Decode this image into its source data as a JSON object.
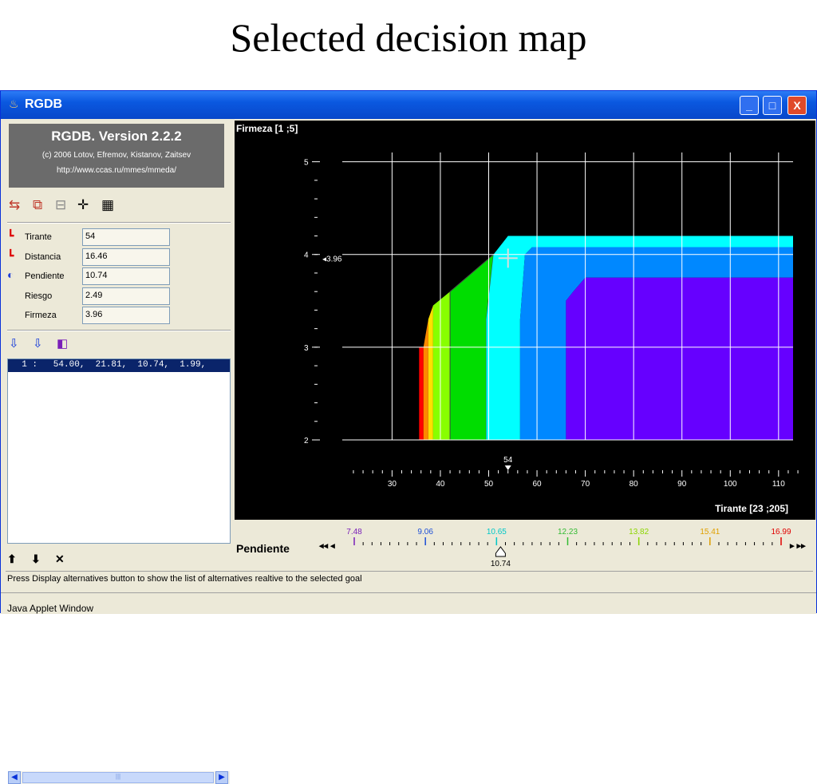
{
  "slide": {
    "title": "Selected decision map"
  },
  "window": {
    "title": "RGDB",
    "controls": {
      "minimize": "_",
      "maximize": "□",
      "close": "X"
    }
  },
  "info": {
    "title": "RGDB. Version 2.2.2",
    "authors": "(c) 2006 Lotov, Efremov, Kistanov, Zaitsev",
    "url": "http://www.ccas.ru/mmes/mmeda/"
  },
  "fields": [
    {
      "label": "Tirante",
      "value": "54"
    },
    {
      "label": "Distancia",
      "value": "16.46"
    },
    {
      "label": "Pendiente",
      "value": "10.74"
    },
    {
      "label": "Riesgo",
      "value": "2.49"
    },
    {
      "label": "Firmeza",
      "value": "3.96"
    }
  ],
  "alternatives": [
    {
      "text": "  1 :   54.00,  21.81,  10.74,  1.99,"
    }
  ],
  "status": "Press Display alternatives button to show the list of alternatives realtive to the selected goal",
  "applet": "Java Applet Window",
  "colors": {
    "background": "#000000",
    "zones": [
      "#ff0000",
      "#ff8800",
      "#ffe000",
      "#88ff00",
      "#00dd00",
      "#00ffff",
      "#0088ff",
      "#6600ff"
    ]
  },
  "chart_data": {
    "type": "area",
    "y_axis_label": "Firmeza [1 ;5]",
    "x_axis_label": "Tirante [23 ;205]",
    "x_ticks": [
      30,
      40,
      50,
      60,
      70,
      80,
      90,
      100,
      110
    ],
    "y_ticks": [
      2,
      3,
      4,
      5
    ],
    "xlim": [
      23,
      113
    ],
    "ylim": [
      2,
      5.1
    ],
    "grid": true,
    "selected_point": {
      "x": 54,
      "y": 3.96,
      "x_label": "54",
      "y_label": "3.96"
    },
    "boundaries": [
      {
        "zone": 0,
        "color": "#ff0000",
        "points": [
          [
            35.6,
            2
          ],
          [
            35.6,
            3
          ],
          [
            36.5,
            3
          ],
          [
            36.5,
            2
          ]
        ]
      },
      {
        "zone": 1,
        "color": "#ff8800",
        "points": [
          [
            36.5,
            2
          ],
          [
            36.5,
            3
          ],
          [
            37.5,
            3.3
          ],
          [
            37.5,
            2
          ]
        ]
      },
      {
        "zone": 2,
        "color": "#ffe000",
        "points": [
          [
            37.5,
            2
          ],
          [
            37.5,
            3.3
          ],
          [
            38.5,
            3.45
          ],
          [
            38.5,
            2
          ]
        ]
      },
      {
        "zone": 3,
        "color": "#88ff00",
        "points": [
          [
            38.5,
            2
          ],
          [
            38.5,
            3.45
          ],
          [
            42,
            3.6
          ],
          [
            42,
            2
          ]
        ]
      },
      {
        "zone": 4,
        "color": "#00dd00",
        "points": [
          [
            42,
            2
          ],
          [
            42,
            3.6
          ],
          [
            51,
            4.0
          ],
          [
            49.5,
            3.3
          ],
          [
            49.5,
            2
          ]
        ]
      },
      {
        "zone": 5,
        "color": "#00ffff",
        "points": [
          [
            49.5,
            2
          ],
          [
            49.5,
            3.3
          ],
          [
            51,
            4.0
          ],
          [
            54,
            4.2
          ],
          [
            113,
            4.2
          ],
          [
            113,
            4.08
          ],
          [
            59,
            4.08
          ],
          [
            57.5,
            4.0
          ],
          [
            56.5,
            3.3
          ],
          [
            56.5,
            2
          ]
        ]
      },
      {
        "zone": 6,
        "color": "#0088ff",
        "points": [
          [
            56.5,
            2
          ],
          [
            56.5,
            3.3
          ],
          [
            57.5,
            4.0
          ],
          [
            59,
            4.08
          ],
          [
            113,
            4.08
          ],
          [
            113,
            3.75
          ],
          [
            70,
            3.75
          ],
          [
            67.5,
            3.6
          ],
          [
            66,
            3.5
          ],
          [
            66,
            2
          ]
        ]
      },
      {
        "zone": 7,
        "color": "#6600ff",
        "points": [
          [
            66,
            2
          ],
          [
            66,
            3.5
          ],
          [
            67.5,
            3.6
          ],
          [
            70,
            3.75
          ],
          [
            113,
            3.75
          ],
          [
            113,
            2
          ]
        ]
      }
    ],
    "legend": {
      "label": "Pendiente",
      "values": [
        "7.48",
        "9.06",
        "10.65",
        "12.23",
        "13.82",
        "15.41",
        "16.99"
      ],
      "colors": [
        "#7a1fb8",
        "#1d4fd8",
        "#00c8c8",
        "#33bb33",
        "#8cd600",
        "#e0a000",
        "#e00000"
      ],
      "selected": "10.74"
    }
  }
}
